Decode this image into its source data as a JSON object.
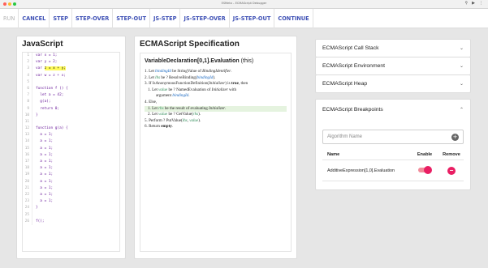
{
  "window": {
    "title": "ESMeta – ECMAScript Debugger"
  },
  "toolbar": {
    "buttons": [
      {
        "label": "RUN",
        "enabled": false
      },
      {
        "label": "CANCEL",
        "enabled": true
      },
      {
        "label": "STEP",
        "enabled": true
      },
      {
        "label": "STEP-OVER",
        "enabled": true
      },
      {
        "label": "STEP-OUT",
        "enabled": true
      },
      {
        "label": "JS-STEP",
        "enabled": true
      },
      {
        "label": "JS-STEP-OVER",
        "enabled": true
      },
      {
        "label": "JS-STEP-OUT",
        "enabled": true
      },
      {
        "label": "CONTINUE",
        "enabled": true
      }
    ]
  },
  "js_panel": {
    "title": "JavaScript",
    "lines": [
      {
        "n": "1",
        "code": "var x = 1;"
      },
      {
        "n": "2",
        "code": "var y = 2;"
      },
      {
        "n": "3",
        "pre": "var ",
        "hl": "z = x + y",
        "post": ";"
      },
      {
        "n": "4",
        "code": "var w = z + x;"
      },
      {
        "n": "5",
        "code": ""
      },
      {
        "n": "6",
        "code": "function f () {"
      },
      {
        "n": "7",
        "code": "  let a = 42;"
      },
      {
        "n": "8",
        "code": "  g(a);"
      },
      {
        "n": "9",
        "code": "  return 0;"
      },
      {
        "n": "10",
        "code": "}"
      },
      {
        "n": "11",
        "code": ""
      },
      {
        "n": "12",
        "code": "function g(a) {"
      },
      {
        "n": "13",
        "code": "  a = 1;"
      },
      {
        "n": "14",
        "code": "  a = 1;"
      },
      {
        "n": "15",
        "code": "  a = 1;"
      },
      {
        "n": "16",
        "code": "  a = 1;"
      },
      {
        "n": "17",
        "code": "  a = 1;"
      },
      {
        "n": "18",
        "code": "  a = 1;"
      },
      {
        "n": "19",
        "code": "  a = 1;"
      },
      {
        "n": "20",
        "code": "  a = 1;"
      },
      {
        "n": "21",
        "code": "  a = 1;"
      },
      {
        "n": "22",
        "code": "  a = 1;"
      },
      {
        "n": "23",
        "code": "  a = 1;"
      },
      {
        "n": "24",
        "code": "}"
      },
      {
        "n": "25",
        "code": ""
      },
      {
        "n": "26",
        "code": "f();"
      }
    ]
  },
  "spec_panel": {
    "title": "ECMAScript Specification",
    "algorithm": "VariableDeclaration[0,1].Evaluation",
    "algorithm_suffix": "(this)",
    "steps": [
      {
        "cls": "",
        "parts": [
          [
            "",
            "1. Let "
          ],
          [
            "blue",
            "bindingId"
          ],
          [
            "",
            " be StringValue of "
          ],
          [
            "i",
            "BindingIdentifier"
          ],
          [
            "",
            "."
          ]
        ]
      },
      {
        "cls": "",
        "parts": [
          [
            "",
            "2. Let "
          ],
          [
            "alias",
            "lhs"
          ],
          [
            "",
            " be ? ResolveBinding("
          ],
          [
            "blue",
            "bindingId"
          ],
          [
            "",
            ")."
          ]
        ]
      },
      {
        "cls": "",
        "parts": [
          [
            "",
            "3. If IsAnonymousFunctionDefinition("
          ],
          [
            "i",
            "Initializer"
          ],
          [
            "",
            ") is "
          ],
          [
            "b",
            "true"
          ],
          [
            "",
            ", then"
          ]
        ]
      },
      {
        "cls": "ind",
        "parts": [
          [
            "",
            "1. Let "
          ],
          [
            "alias",
            "value"
          ],
          [
            "",
            " be ? NamedEvaluation of "
          ],
          [
            "i",
            "Initializer"
          ],
          [
            "",
            " with"
          ]
        ]
      },
      {
        "cls": "wrap",
        "parts": [
          [
            "",
            "argument "
          ],
          [
            "blue",
            "bindingId"
          ],
          [
            "",
            "."
          ]
        ]
      },
      {
        "cls": "",
        "parts": [
          [
            "",
            "4. Else,"
          ]
        ]
      },
      {
        "cls": "ind active",
        "parts": [
          [
            "",
            "1. Let "
          ],
          [
            "alias",
            "rhs"
          ],
          [
            "",
            " be the result of evaluating "
          ],
          [
            "i",
            "Initializer"
          ],
          [
            "",
            "."
          ]
        ]
      },
      {
        "cls": "ind",
        "parts": [
          [
            "",
            "2. Let "
          ],
          [
            "alias",
            "value"
          ],
          [
            "",
            " be ? GetValue("
          ],
          [
            "alias",
            "rhs"
          ],
          [
            "",
            ")."
          ]
        ]
      },
      {
        "cls": "",
        "parts": [
          [
            "",
            "5. Perform ? PutValue("
          ],
          [
            "alias",
            "lhs"
          ],
          [
            "",
            ", "
          ],
          [
            "alias",
            "value"
          ],
          [
            "",
            ")."
          ]
        ]
      },
      {
        "cls": "",
        "parts": [
          [
            "",
            "6. Return "
          ],
          [
            "b",
            "empty"
          ],
          [
            "",
            "."
          ]
        ]
      }
    ]
  },
  "right_panels": {
    "call_stack": "ECMAScript Call Stack",
    "environment": "ECMAScript Environment",
    "heap": "ECMAScript Heap",
    "breakpoints": {
      "title": "ECMAScript Breakpoints",
      "input_placeholder": "Algorithm Name",
      "col_name": "Name",
      "col_enable": "Enable",
      "col_remove": "Remove",
      "rows": [
        {
          "name": "AdditiveExpression[1,0].Evaluation",
          "enabled": true
        }
      ]
    }
  },
  "colors": {
    "accent": "#3f51b5",
    "toggle_on": "#e91e63",
    "highlight": "#fffb5c",
    "active_step": "#e5f3df",
    "traffic_red": "#ff5f57",
    "traffic_yellow": "#febc2e",
    "traffic_green": "#28c840"
  },
  "icons": [
    "chevron-down-icon",
    "chevron-up-icon",
    "add-icon",
    "remove-icon"
  ]
}
